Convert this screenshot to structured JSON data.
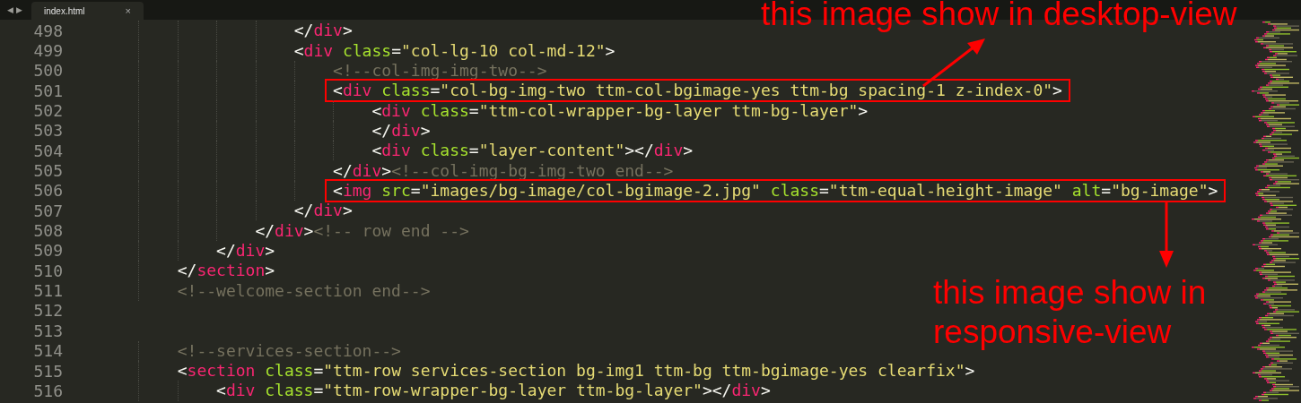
{
  "tabs": [
    {
      "label": "index.html",
      "close": "×",
      "selected": true
    }
  ],
  "nav": [
    "◀",
    "▶"
  ],
  "lines": [
    {
      "number": "498",
      "tokens": [
        {
          "kind": "punct",
          "text": "                    </"
        },
        {
          "kind": "tag",
          "text": "div"
        },
        {
          "kind": "punct",
          "text": ">"
        }
      ]
    },
    {
      "number": "499",
      "tokens": [
        {
          "kind": "punct",
          "text": "                    <"
        },
        {
          "kind": "tag",
          "text": "div"
        },
        {
          "kind": "attr",
          "text": " class"
        },
        {
          "kind": "punct",
          "text": "="
        },
        {
          "kind": "string",
          "text": "\"col-lg-10 col-md-12\""
        },
        {
          "kind": "punct",
          "text": ">"
        }
      ]
    },
    {
      "number": "500",
      "tokens": [
        {
          "kind": "comment",
          "text": "                        <!--col-img-img-two-->"
        }
      ]
    },
    {
      "number": "501",
      "boxed": true,
      "tokens": [
        {
          "kind": "punct",
          "text": "                        <"
        },
        {
          "kind": "tag",
          "text": "div"
        },
        {
          "kind": "attr",
          "text": " class"
        },
        {
          "kind": "punct",
          "text": "="
        },
        {
          "kind": "string",
          "text": "\"col-bg-img-two ttm-col-bgimage-yes ttm-bg spacing-1 z-index-0\""
        },
        {
          "kind": "punct",
          "text": ">"
        }
      ]
    },
    {
      "number": "502",
      "tokens": [
        {
          "kind": "punct",
          "text": "                            <"
        },
        {
          "kind": "tag",
          "text": "div"
        },
        {
          "kind": "attr",
          "text": " class"
        },
        {
          "kind": "punct",
          "text": "="
        },
        {
          "kind": "string",
          "text": "\"ttm-col-wrapper-bg-layer ttm-bg-layer\""
        },
        {
          "kind": "punct",
          "text": ">"
        }
      ]
    },
    {
      "number": "503",
      "tokens": [
        {
          "kind": "punct",
          "text": "                            </"
        },
        {
          "kind": "tag",
          "text": "div"
        },
        {
          "kind": "punct",
          "text": ">"
        }
      ]
    },
    {
      "number": "504",
      "tokens": [
        {
          "kind": "punct",
          "text": "                            <"
        },
        {
          "kind": "tag",
          "text": "div"
        },
        {
          "kind": "attr",
          "text": " class"
        },
        {
          "kind": "punct",
          "text": "="
        },
        {
          "kind": "string",
          "text": "\"layer-content\""
        },
        {
          "kind": "punct",
          "text": "></"
        },
        {
          "kind": "tag",
          "text": "div"
        },
        {
          "kind": "punct",
          "text": ">"
        }
      ]
    },
    {
      "number": "505",
      "tokens": [
        {
          "kind": "punct",
          "text": "                        </"
        },
        {
          "kind": "tag",
          "text": "div"
        },
        {
          "kind": "punct",
          "text": ">"
        },
        {
          "kind": "comment",
          "text": "<!--col-img-bg-img-two end-->"
        }
      ]
    },
    {
      "number": "506",
      "boxed": true,
      "tokens": [
        {
          "kind": "punct",
          "text": "                        <"
        },
        {
          "kind": "tag",
          "text": "img"
        },
        {
          "kind": "attr",
          "text": " src"
        },
        {
          "kind": "punct",
          "text": "="
        },
        {
          "kind": "string",
          "text": "\"images/bg-image/col-bgimage-2.jpg\""
        },
        {
          "kind": "attr",
          "text": " class"
        },
        {
          "kind": "punct",
          "text": "="
        },
        {
          "kind": "string",
          "text": "\"ttm-equal-height-image\""
        },
        {
          "kind": "attr",
          "text": " alt"
        },
        {
          "kind": "punct",
          "text": "="
        },
        {
          "kind": "string",
          "text": "\"bg-image\""
        },
        {
          "kind": "punct",
          "text": ">"
        }
      ]
    },
    {
      "number": "507",
      "tokens": [
        {
          "kind": "punct",
          "text": "                    </"
        },
        {
          "kind": "tag",
          "text": "div"
        },
        {
          "kind": "punct",
          "text": ">"
        }
      ]
    },
    {
      "number": "508",
      "tokens": [
        {
          "kind": "punct",
          "text": "                </"
        },
        {
          "kind": "tag",
          "text": "div"
        },
        {
          "kind": "punct",
          "text": ">"
        },
        {
          "kind": "comment",
          "text": "<!-- row end -->"
        }
      ]
    },
    {
      "number": "509",
      "tokens": [
        {
          "kind": "punct",
          "text": "            </"
        },
        {
          "kind": "tag",
          "text": "div"
        },
        {
          "kind": "punct",
          "text": ">"
        }
      ]
    },
    {
      "number": "510",
      "tokens": [
        {
          "kind": "punct",
          "text": "        </"
        },
        {
          "kind": "tag",
          "text": "section"
        },
        {
          "kind": "punct",
          "text": ">"
        }
      ]
    },
    {
      "number": "511",
      "tokens": [
        {
          "kind": "comment",
          "text": "        <!--welcome-section end-->"
        }
      ]
    },
    {
      "number": "512"
    },
    {
      "number": "513"
    },
    {
      "number": "514",
      "tokens": [
        {
          "kind": "comment",
          "text": "        <!--services-section-->"
        }
      ]
    },
    {
      "number": "515",
      "tokens": [
        {
          "kind": "punct",
          "text": "        <"
        },
        {
          "kind": "tag",
          "text": "section"
        },
        {
          "kind": "attr",
          "text": " class"
        },
        {
          "kind": "punct",
          "text": "="
        },
        {
          "kind": "string",
          "text": "\"ttm-row services-section bg-img1 ttm-bg ttm-bgimage-yes clearfix\""
        },
        {
          "kind": "punct",
          "text": ">"
        }
      ]
    },
    {
      "number": "516",
      "tokens": [
        {
          "kind": "punct",
          "text": "            <"
        },
        {
          "kind": "tag",
          "text": "div"
        },
        {
          "kind": "attr",
          "text": " class"
        },
        {
          "kind": "punct",
          "text": "="
        },
        {
          "kind": "string",
          "text": "\"ttm-row-wrapper-bg-layer ttm-bg-layer\""
        },
        {
          "kind": "punct",
          "text": "></"
        },
        {
          "kind": "tag",
          "text": "div"
        },
        {
          "kind": "punct",
          "text": ">"
        }
      ]
    }
  ],
  "annotations": [
    {
      "lines": [
        "this image show in desktop-view"
      ]
    },
    {
      "lines": [
        "this image show in",
        "responsive-view"
      ]
    }
  ]
}
